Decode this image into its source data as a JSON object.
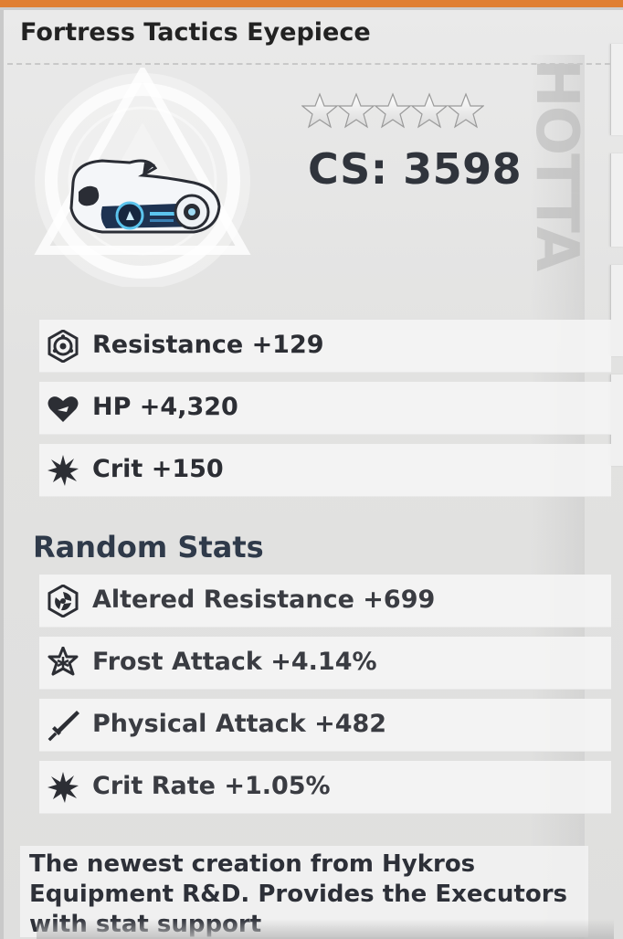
{
  "item": {
    "title": "Fortress Tactics Eyepiece",
    "rating_stars": 5,
    "cs_label": "CS: 3598"
  },
  "watermark": "HOTTA",
  "base_stats": [
    {
      "icon": "resistance-icon",
      "label": "Resistance +129"
    },
    {
      "icon": "heart-icon",
      "label": "HP +4,320"
    },
    {
      "icon": "crit-burst-icon",
      "label": "Crit +150"
    }
  ],
  "random_stats_title": "Random Stats",
  "random_stats": [
    {
      "icon": "altered-resistance-icon",
      "label": "Altered Resistance +699"
    },
    {
      "icon": "frost-attack-icon",
      "label": "Frost Attack +4.14%"
    },
    {
      "icon": "sword-icon",
      "label": "Physical Attack +482"
    },
    {
      "icon": "crit-burst-icon",
      "label": "Crit Rate +1.05%"
    }
  ],
  "description": "The newest creation from Hykros Equipment R&D. Provides the Executors with stat support",
  "colors": {
    "accent_bar": "#e07f33",
    "text_dark": "#2c2e34",
    "row_bg": "#f4f4f4"
  }
}
